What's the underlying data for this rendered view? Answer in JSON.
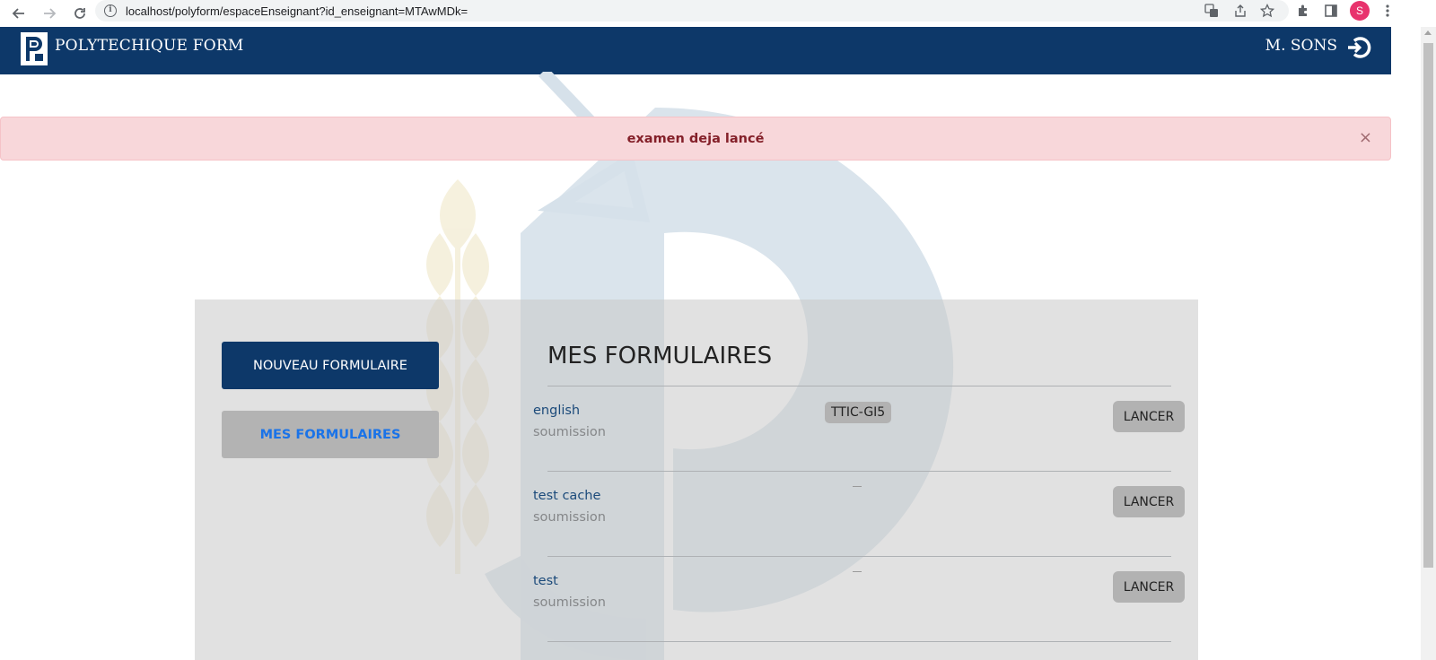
{
  "browser": {
    "url": "localhost/polyform/espaceEnseignant?id_enseignant=MTAwMDk=",
    "avatar_letter": "S"
  },
  "header": {
    "brand": "POLYTECHIQUE FORM",
    "user_name": "M. SONS",
    "bg_color": "#0d3869"
  },
  "alert": {
    "message": "examen deja lancé",
    "close": "×"
  },
  "sidebar": {
    "new_form_label": "NOUVEAU FORMULAIRE",
    "my_forms_label": "MES FORMULAIRES"
  },
  "main": {
    "title": "MES FORMULAIRES",
    "forms": [
      {
        "name": "english",
        "status": "soumission",
        "class_tag": "TTIC-GI5",
        "action": "LANCER"
      },
      {
        "name": "test cache",
        "status": "soumission",
        "class_tag": "",
        "action": "LANCER"
      },
      {
        "name": "test",
        "status": "soumission",
        "class_tag": "",
        "action": "LANCER"
      }
    ]
  }
}
